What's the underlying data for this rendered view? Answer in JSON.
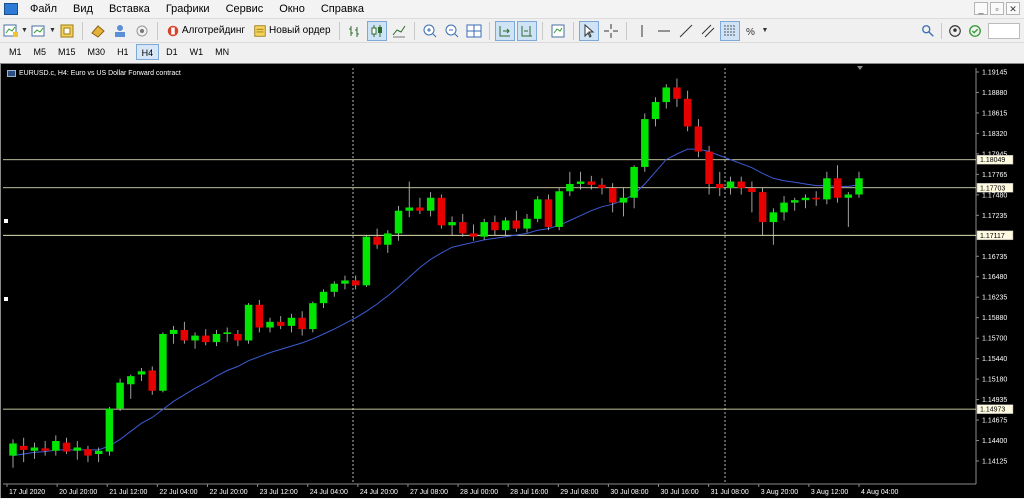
{
  "menu": {
    "items": [
      "Файл",
      "Вид",
      "Вставка",
      "Графики",
      "Сервис",
      "Окно",
      "Справка"
    ],
    "window_controls": [
      "_",
      "▫",
      "✕"
    ]
  },
  "toolbar": {
    "algotrading_label": "Алготрейдинг",
    "new_order_label": "Новый ордер"
  },
  "timeframes": {
    "items": [
      "M1",
      "M5",
      "M15",
      "M30",
      "H1",
      "H4",
      "D1",
      "W1",
      "MN"
    ],
    "active": "H4"
  },
  "chart": {
    "title": "EURUSD.c, H4:  Euro vs US Dollar Forward contract",
    "colors": {
      "background": "#000000",
      "bull": "#00e600",
      "bear": "#e60000",
      "wick": "#c8c8c8",
      "ma": "#3d5bd6",
      "hline": "#ffffcc",
      "axis_text": "#ffffff",
      "grid_dash": "#ffffff",
      "price_label_bg": "#fffbe0"
    },
    "price_axis": [
      "1.19145",
      "1.18880",
      "1.18615",
      "1.18320",
      "1.17945",
      "1.17765",
      "1.17480",
      "1.17235",
      "1.17010",
      "1.16735",
      "1.16480",
      "1.16235",
      "1.15880",
      "1.15700",
      "1.15440",
      "1.15180",
      "1.14935",
      "1.14675",
      "1.14400",
      "1.14125"
    ],
    "time_axis": [
      "17 Jul 2020",
      "20 Jul 20:00",
      "21 Jul 12:00",
      "22 Jul 04:00",
      "22 Jul 20:00",
      "23 Jul 12:00",
      "24 Jul 04:00",
      "24 Jul 20:00",
      "27 Jul 08:00",
      "28 Jul 00:00",
      "28 Jul 16:00",
      "29 Jul 08:00",
      "30 Jul 08:00",
      "30 Jul 16:00",
      "31 Jul 08:00",
      "3 Aug 20:00",
      "3 Aug 12:00",
      "4 Aug 04:00"
    ],
    "hlines": [
      {
        "price": 1.18049,
        "label": "1.18049"
      },
      {
        "price": 1.17703,
        "label": "1.17703"
      },
      {
        "price": 1.17117,
        "label": "1.17117"
      },
      {
        "price": 1.14973,
        "label": "1.14973"
      }
    ],
    "price_min": 1.1405,
    "price_max": 1.1918
  },
  "chart_data": {
    "type": "candlestick",
    "title": "EURUSD.c, H4:  Euro vs US Dollar Forward contract",
    "candles": [
      {
        "o": 1.144,
        "h": 1.146,
        "l": 1.1425,
        "c": 1.1455
      },
      {
        "o": 1.1452,
        "h": 1.1462,
        "l": 1.1432,
        "c": 1.1447
      },
      {
        "o": 1.1446,
        "h": 1.1456,
        "l": 1.1436,
        "c": 1.145
      },
      {
        "o": 1.1449,
        "h": 1.1458,
        "l": 1.144,
        "c": 1.1446
      },
      {
        "o": 1.1446,
        "h": 1.1465,
        "l": 1.144,
        "c": 1.1458
      },
      {
        "o": 1.1456,
        "h": 1.1462,
        "l": 1.1442,
        "c": 1.1445
      },
      {
        "o": 1.1446,
        "h": 1.1458,
        "l": 1.1435,
        "c": 1.145
      },
      {
        "o": 1.1448,
        "h": 1.1452,
        "l": 1.1432,
        "c": 1.144
      },
      {
        "o": 1.1442,
        "h": 1.145,
        "l": 1.1432,
        "c": 1.1446
      },
      {
        "o": 1.1445,
        "h": 1.15,
        "l": 1.144,
        "c": 1.1498
      },
      {
        "o": 1.1498,
        "h": 1.1535,
        "l": 1.1495,
        "c": 1.153
      },
      {
        "o": 1.1528,
        "h": 1.154,
        "l": 1.151,
        "c": 1.1538
      },
      {
        "o": 1.154,
        "h": 1.1548,
        "l": 1.1532,
        "c": 1.1544
      },
      {
        "o": 1.1545,
        "h": 1.155,
        "l": 1.1515,
        "c": 1.152
      },
      {
        "o": 1.152,
        "h": 1.1592,
        "l": 1.1518,
        "c": 1.159
      },
      {
        "o": 1.159,
        "h": 1.16,
        "l": 1.1578,
        "c": 1.1595
      },
      {
        "o": 1.1595,
        "h": 1.1605,
        "l": 1.1578,
        "c": 1.1582
      },
      {
        "o": 1.1582,
        "h": 1.1592,
        "l": 1.1572,
        "c": 1.1588
      },
      {
        "o": 1.1588,
        "h": 1.1596,
        "l": 1.1576,
        "c": 1.158
      },
      {
        "o": 1.158,
        "h": 1.1595,
        "l": 1.1575,
        "c": 1.159
      },
      {
        "o": 1.159,
        "h": 1.1598,
        "l": 1.158,
        "c": 1.1592
      },
      {
        "o": 1.159,
        "h": 1.1595,
        "l": 1.1575,
        "c": 1.1582
      },
      {
        "o": 1.1582,
        "h": 1.1628,
        "l": 1.1578,
        "c": 1.1626
      },
      {
        "o": 1.1626,
        "h": 1.1632,
        "l": 1.1592,
        "c": 1.1598
      },
      {
        "o": 1.1598,
        "h": 1.161,
        "l": 1.1592,
        "c": 1.1605
      },
      {
        "o": 1.1605,
        "h": 1.1612,
        "l": 1.1596,
        "c": 1.16
      },
      {
        "o": 1.16,
        "h": 1.1615,
        "l": 1.1592,
        "c": 1.161
      },
      {
        "o": 1.161,
        "h": 1.1618,
        "l": 1.1588,
        "c": 1.1596
      },
      {
        "o": 1.1596,
        "h": 1.163,
        "l": 1.1592,
        "c": 1.1628
      },
      {
        "o": 1.1628,
        "h": 1.1645,
        "l": 1.1622,
        "c": 1.1642
      },
      {
        "o": 1.1642,
        "h": 1.1655,
        "l": 1.1636,
        "c": 1.1652
      },
      {
        "o": 1.1652,
        "h": 1.1662,
        "l": 1.1645,
        "c": 1.1656
      },
      {
        "o": 1.1656,
        "h": 1.1662,
        "l": 1.1645,
        "c": 1.165
      },
      {
        "o": 1.165,
        "h": 1.1712,
        "l": 1.1648,
        "c": 1.171
      },
      {
        "o": 1.171,
        "h": 1.172,
        "l": 1.1695,
        "c": 1.17
      },
      {
        "o": 1.17,
        "h": 1.1718,
        "l": 1.169,
        "c": 1.1714
      },
      {
        "o": 1.1714,
        "h": 1.1748,
        "l": 1.1705,
        "c": 1.1742
      },
      {
        "o": 1.1742,
        "h": 1.1778,
        "l": 1.1734,
        "c": 1.1746
      },
      {
        "o": 1.1746,
        "h": 1.1758,
        "l": 1.1738,
        "c": 1.1742
      },
      {
        "o": 1.1742,
        "h": 1.1765,
        "l": 1.1735,
        "c": 1.1758
      },
      {
        "o": 1.1758,
        "h": 1.1762,
        "l": 1.172,
        "c": 1.1724
      },
      {
        "o": 1.1724,
        "h": 1.1735,
        "l": 1.1712,
        "c": 1.1728
      },
      {
        "o": 1.1728,
        "h": 1.1738,
        "l": 1.171,
        "c": 1.1714
      },
      {
        "o": 1.1714,
        "h": 1.1725,
        "l": 1.1705,
        "c": 1.171
      },
      {
        "o": 1.171,
        "h": 1.1732,
        "l": 1.1706,
        "c": 1.1728
      },
      {
        "o": 1.1728,
        "h": 1.1736,
        "l": 1.1712,
        "c": 1.1718
      },
      {
        "o": 1.1718,
        "h": 1.1734,
        "l": 1.1712,
        "c": 1.173
      },
      {
        "o": 1.173,
        "h": 1.1742,
        "l": 1.1716,
        "c": 1.172
      },
      {
        "o": 1.172,
        "h": 1.1738,
        "l": 1.1715,
        "c": 1.1732
      },
      {
        "o": 1.1732,
        "h": 1.176,
        "l": 1.1728,
        "c": 1.1756
      },
      {
        "o": 1.1756,
        "h": 1.1762,
        "l": 1.1718,
        "c": 1.1722
      },
      {
        "o": 1.1722,
        "h": 1.177,
        "l": 1.1718,
        "c": 1.1766
      },
      {
        "o": 1.1766,
        "h": 1.179,
        "l": 1.176,
        "c": 1.1775
      },
      {
        "o": 1.1775,
        "h": 1.179,
        "l": 1.1768,
        "c": 1.1778
      },
      {
        "o": 1.1778,
        "h": 1.1785,
        "l": 1.1768,
        "c": 1.1774
      },
      {
        "o": 1.1774,
        "h": 1.1782,
        "l": 1.1762,
        "c": 1.177
      },
      {
        "o": 1.177,
        "h": 1.1776,
        "l": 1.174,
        "c": 1.1752
      },
      {
        "o": 1.1752,
        "h": 1.177,
        "l": 1.1735,
        "c": 1.1758
      },
      {
        "o": 1.1758,
        "h": 1.1798,
        "l": 1.1745,
        "c": 1.1796
      },
      {
        "o": 1.1796,
        "h": 1.1862,
        "l": 1.179,
        "c": 1.1855
      },
      {
        "o": 1.1855,
        "h": 1.1882,
        "l": 1.1846,
        "c": 1.1876
      },
      {
        "o": 1.1876,
        "h": 1.1898,
        "l": 1.1868,
        "c": 1.1894
      },
      {
        "o": 1.1894,
        "h": 1.1905,
        "l": 1.187,
        "c": 1.188
      },
      {
        "o": 1.188,
        "h": 1.189,
        "l": 1.184,
        "c": 1.1846
      },
      {
        "o": 1.1846,
        "h": 1.1855,
        "l": 1.1808,
        "c": 1.1815
      },
      {
        "o": 1.1815,
        "h": 1.1822,
        "l": 1.1762,
        "c": 1.1775
      },
      {
        "o": 1.1775,
        "h": 1.179,
        "l": 1.176,
        "c": 1.177
      },
      {
        "o": 1.177,
        "h": 1.1784,
        "l": 1.1762,
        "c": 1.1778
      },
      {
        "o": 1.1778,
        "h": 1.1784,
        "l": 1.1762,
        "c": 1.177
      },
      {
        "o": 1.177,
        "h": 1.1778,
        "l": 1.174,
        "c": 1.1765
      },
      {
        "o": 1.1765,
        "h": 1.177,
        "l": 1.1712,
        "c": 1.1728
      },
      {
        "o": 1.1728,
        "h": 1.1745,
        "l": 1.17,
        "c": 1.174
      },
      {
        "o": 1.174,
        "h": 1.176,
        "l": 1.173,
        "c": 1.1752
      },
      {
        "o": 1.1752,
        "h": 1.1758,
        "l": 1.1742,
        "c": 1.1755
      },
      {
        "o": 1.1755,
        "h": 1.1762,
        "l": 1.1745,
        "c": 1.1758
      },
      {
        "o": 1.1758,
        "h": 1.1766,
        "l": 1.1748,
        "c": 1.1756
      },
      {
        "o": 1.1756,
        "h": 1.179,
        "l": 1.175,
        "c": 1.1782
      },
      {
        "o": 1.1782,
        "h": 1.1798,
        "l": 1.1752,
        "c": 1.1758
      },
      {
        "o": 1.1758,
        "h": 1.1765,
        "l": 1.1722,
        "c": 1.1762
      },
      {
        "o": 1.1762,
        "h": 1.179,
        "l": 1.1758,
        "c": 1.1782
      }
    ],
    "moving_average": [
      1.144,
      1.1442,
      1.1444,
      1.1445,
      1.1447,
      1.1447,
      1.1447,
      1.1447,
      1.1447,
      1.1452,
      1.146,
      1.147,
      1.148,
      1.1487,
      1.1497,
      1.1507,
      1.1515,
      1.1523,
      1.153,
      1.1538,
      1.1545,
      1.155,
      1.1557,
      1.1562,
      1.1567,
      1.1571,
      1.1575,
      1.1579,
      1.1584,
      1.159,
      1.1596,
      1.1603,
      1.161,
      1.1618,
      1.1627,
      1.1637,
      1.1648,
      1.166,
      1.1672,
      1.1682,
      1.169,
      1.1697,
      1.17,
      1.1703,
      1.1706,
      1.1708,
      1.171,
      1.1712,
      1.1714,
      1.1718,
      1.172,
      1.1724,
      1.173,
      1.1736,
      1.1742,
      1.1747,
      1.175,
      1.1755,
      1.1762,
      1.1775,
      1.179,
      1.1805,
      1.1812,
      1.1818,
      1.1818,
      1.1815,
      1.181,
      1.1805,
      1.18,
      1.1795,
      1.1788,
      1.1782,
      1.1779,
      1.1777,
      1.1775,
      1.1773,
      1.1773,
      1.1772,
      1.1772,
      1.1774
    ],
    "ylim": [
      1.1405,
      1.1918
    ],
    "grid": false
  }
}
